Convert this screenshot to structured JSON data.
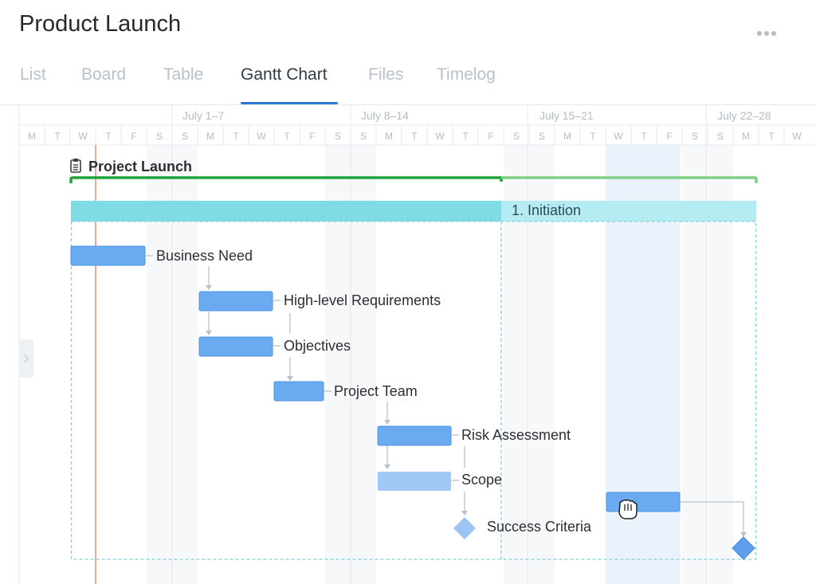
{
  "header": {
    "title": "Product Launch",
    "more_icon": "more-horizontal-icon"
  },
  "tabs": [
    {
      "label": "List",
      "active": false
    },
    {
      "label": "Board",
      "active": false
    },
    {
      "label": "Table",
      "active": false
    },
    {
      "label": "Gantt Chart",
      "active": true
    },
    {
      "label": "Files",
      "active": false
    },
    {
      "label": "Timelog",
      "active": false
    }
  ],
  "timeline": {
    "weeks": [
      "July 1–7",
      "July 8–14",
      "July 15–21",
      "July 22–28"
    ],
    "days": [
      "M",
      "T",
      "W",
      "T",
      "F",
      "S",
      "S",
      "M",
      "T",
      "W",
      "T",
      "F",
      "S",
      "S",
      "M",
      "T",
      "W",
      "T",
      "F",
      "S",
      "S",
      "M",
      "T",
      "W",
      "T",
      "F",
      "S",
      "S",
      "M",
      "T",
      "W"
    ]
  },
  "project": {
    "name": "Project Launch",
    "icon": "clipboard-icon"
  },
  "phase": {
    "name": "1. Initiation"
  },
  "tasks": [
    {
      "name": "Business Need"
    },
    {
      "name": "High-level Requirements"
    },
    {
      "name": "Objectives"
    },
    {
      "name": "Project Team"
    },
    {
      "name": "Risk Assessment"
    },
    {
      "name": "Scope"
    },
    {
      "name": "Success Criteria"
    }
  ],
  "colors": {
    "accent": "#2a7ad1",
    "project_bar": "#1fa33a",
    "phase_bar": "#7fdce4",
    "task_bar": "#6aaaf0",
    "today_line": "#f2a59c"
  }
}
